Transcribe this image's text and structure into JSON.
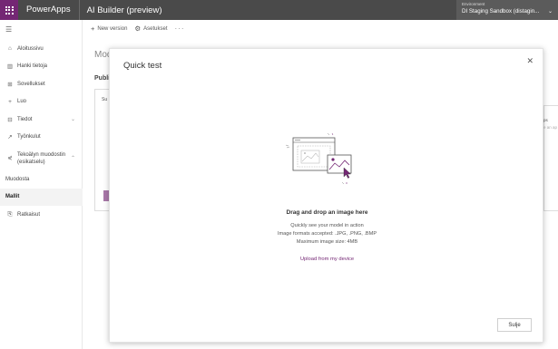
{
  "topbar": {
    "brand": "PowerApps",
    "app_title": "AI Builder (preview)",
    "environment_label": "Environment",
    "environment_value": "DI Staging Sandbox (distagin...",
    "waffle_color": "#742774"
  },
  "sidebar": {
    "items": [
      {
        "label": "Aloitussivu",
        "icon": "home-icon"
      },
      {
        "label": "Hanki tietoja",
        "icon": "book-icon"
      },
      {
        "label": "Sovellukset",
        "icon": "apps-icon"
      },
      {
        "label": "Luo",
        "icon": "plus-icon"
      },
      {
        "label": "Tiedot",
        "icon": "table-icon"
      },
      {
        "label": "Työnkulut",
        "icon": "flow-icon"
      },
      {
        "label": "Tekoälyn muodostin (esikatselu)",
        "icon": "ai-builder-icon"
      },
      {
        "label": "Muodosta",
        "icon": ""
      },
      {
        "label": "Mallit",
        "icon": ""
      },
      {
        "label": "Ratkaisut",
        "icon": "solutions-icon"
      }
    ]
  },
  "cmdbar": {
    "new_version": "New version",
    "settings": "Asetukset",
    "more": "···"
  },
  "background": {
    "title": "Mod",
    "published": "Publi",
    "card_text": "Su",
    "right_text_1": "ps",
    "right_text_2": "e an ap"
  },
  "dialog": {
    "title": "Quick test",
    "drop_title": "Drag and drop an image here",
    "line1": "Quickly see your model in action",
    "line2": "Image formats accepted: .JPG, .PNG, .BMP",
    "line3": "Maximum image size: 4MB",
    "upload_link": "Upload from my device",
    "close_button": "Sulje"
  },
  "colors": {
    "accent": "#742774",
    "topbar": "#4a4a4a"
  }
}
